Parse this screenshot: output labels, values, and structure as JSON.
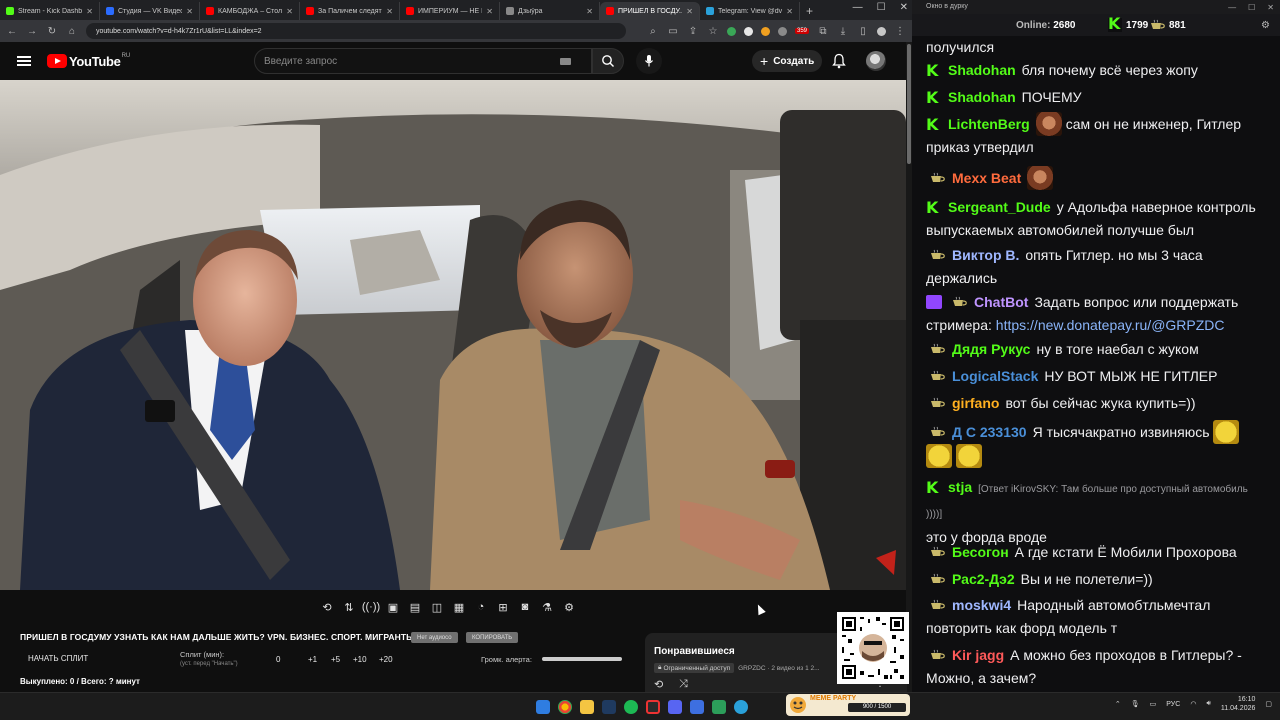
{
  "browser": {
    "tabs": [
      {
        "title": "Stream - Kick Dashboard",
        "color": "#53fc18",
        "active": false
      },
      {
        "title": "Студия — VK Видео | Л...",
        "color": "#2b6cff",
        "active": false
      },
      {
        "title": "КАМБОДЖА – Столица ...",
        "color": "#ff0000",
        "active": false
      },
      {
        "title": "За Паличем следят в ...",
        "color": "#ff0000",
        "active": false
      },
      {
        "title": "ИМПЕРИУМ — НЕ РО...",
        "color": "#ff0000",
        "active": false
      },
      {
        "title": "Дзыўра",
        "color": "#888888",
        "active": false
      },
      {
        "title": "ПРИШЕЛ В ГОСДУ...",
        "color": "#ff0000",
        "active": true
      },
      {
        "title": "Telegram: View @dvoс...",
        "color": "#2aa1da",
        "active": false
      }
    ],
    "url": "youtube.com/watch?v=d-h4k7Zr1rU&list=LL&index=2",
    "ext_badge": "359"
  },
  "youtube": {
    "logo_text": "YouTube",
    "region": "RU",
    "search_placeholder": "Введите запрос",
    "create_label": "Создать"
  },
  "video": {
    "title": "ПРИШЕЛ В ГОСДУМУ УЗНАТЬ КАК НАМ ДАЛЬШЕ ЖИТЬ? VPN. БИЗНЕС. СПОРТ. МИГРАНТЫ.",
    "pill_no_audio": "Нет аудиосо",
    "pill_copy": "КОПИРОВАТЬ"
  },
  "split": {
    "start_label": "НАЧАТЬ СПЛИТ",
    "minutes_label": "Сплит (мин):",
    "minutes_hint": "(уст. перед \"Начать\")",
    "value": "0",
    "increments": [
      "+1",
      "+5",
      "+10",
      "+20"
    ],
    "alert_label": "Громк. алерта:",
    "bought": "Выкуплено: 0 / Всего: ? минут"
  },
  "liked": {
    "title": "Понравившиеся",
    "limited": "Ограниченный доступ",
    "meta": "GRPZDC · 2 видео из 1 2..."
  },
  "chat": {
    "window_title": "Окно в дурку",
    "online_label": "Online:",
    "online_value": "2680",
    "kick_count": "1799",
    "other_count": "881",
    "messages": [
      {
        "badge": "none",
        "user": "",
        "color": "#efeff1",
        "text": "получился"
      },
      {
        "badge": "kick",
        "user": "Shadohan",
        "color": "#53fc18",
        "text": "бля почему всё через жопу"
      },
      {
        "badge": "kick",
        "user": "Shadohan",
        "color": "#53fc18",
        "text": "ПОЧЕМУ"
      },
      {
        "badge": "kick",
        "user": "LichtenBerg",
        "color": "#53fc18",
        "text": "сам он не инженер, Гитлер приказ утвердил",
        "emote": "face"
      },
      {
        "badge": "cup",
        "user": "Mexx Beat",
        "color": "#ff6b3d",
        "text": "",
        "emote": "face"
      },
      {
        "badge": "kick",
        "user": "Sergeant_Dude",
        "color": "#53fc18",
        "text": "у Адольфа наверное контроль выпускаемых автомобилей получше был"
      },
      {
        "badge": "cup",
        "user": "Виктор В.",
        "color": "#9fb7ff",
        "text": "опять Гитлер. но мы 3 часа держались"
      },
      {
        "badge": "bot",
        "user": "ChatBot",
        "color": "#bf94ff",
        "text": "Задать вопрос или поддержать стримера:",
        "link": "https://new.donatepay.ru/@GRPZDC"
      },
      {
        "badge": "cup",
        "user": "Дядя Рукус",
        "color": "#53fc18",
        "text": "ну в тоге наебал с жуком"
      },
      {
        "badge": "cup",
        "user": "LogicalStack",
        "color": "#4a8fd8",
        "text": "НУ ВОТ МЫЖ НЕ ГИТЛЕР"
      },
      {
        "badge": "cup",
        "user": "girfano",
        "color": "#ffb020",
        "text": "вот бы сейчас жука купить=))"
      },
      {
        "badge": "cup",
        "user": "Д С 233130",
        "color": "#4a8fd8",
        "text": "Я тысячакратно извиняюсь",
        "emote": "yellow3"
      },
      {
        "badge": "kick",
        "user": "stja",
        "color": "#53fc18",
        "reply": "[Ответ iKirovSKY: Там больше про доступный автомобиль ))))]",
        "text": "это у форда вроде"
      },
      {
        "badge": "cup",
        "user": "Бесогон",
        "color": "#53fc18",
        "text": "А где кстати Ё Мобили Прохорова"
      },
      {
        "badge": "cup",
        "user": "Рас2-Дэ2",
        "color": "#53fc18",
        "text": "Вы и не полетели=))"
      },
      {
        "badge": "cup",
        "user": "moskwi4",
        "color": "#9fb7ff",
        "text": "Народный автомобтльмечтал повторить как форд модель т"
      },
      {
        "badge": "cup",
        "user": "Kir jagg",
        "color": "#ff5a5a",
        "text": "А можно без проходов в Гитлеры? - Можно, а зачем?"
      }
    ]
  },
  "taskbar": {
    "meme_label": "MEME PARTY",
    "meme_count": "900 / 1500",
    "lang": "РУС",
    "time": "16:10",
    "date": "11.04.2026"
  }
}
